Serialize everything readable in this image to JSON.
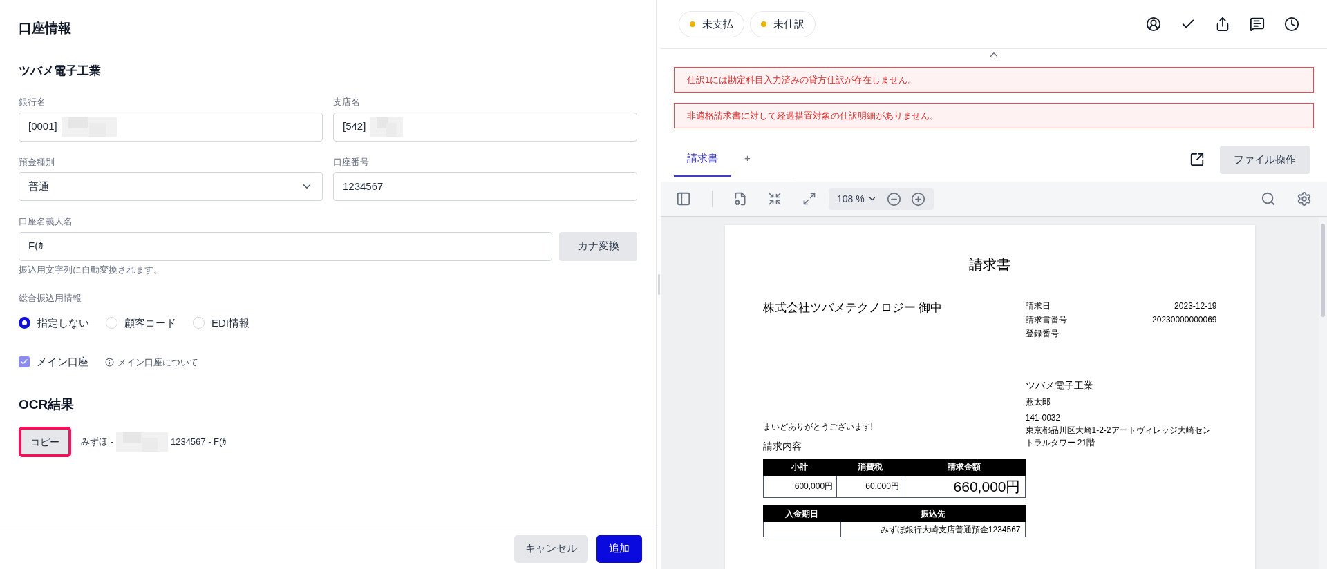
{
  "account_form": {
    "title": "口座情報",
    "company": "ツバメ電子工業",
    "bank": {
      "label": "銀行名",
      "value": "[0001]",
      "redacted": true
    },
    "branch": {
      "label": "支店名",
      "value": "[542]",
      "redacted": true
    },
    "deposit_type": {
      "label": "預金種別",
      "value": "普通"
    },
    "account_number": {
      "label": "口座番号",
      "value": "1234567"
    },
    "holder": {
      "label": "口座名義人名",
      "value": "F(ｶ",
      "button": "カナ変換",
      "hint": "振込用文字列に自動変換されます。"
    },
    "transfer_info": {
      "label": "総合振込用情報",
      "options": [
        {
          "label": "指定しない",
          "selected": true
        },
        {
          "label": "顧客コード",
          "selected": false
        },
        {
          "label": "EDI情報",
          "selected": false
        }
      ]
    },
    "main_account": {
      "label": "メイン口座",
      "checked": true,
      "link": "メイン口座について"
    }
  },
  "ocr": {
    "title": "OCR結果",
    "copy_button": "コピー",
    "highlighted": true,
    "text_before": "みずほ -",
    "redacted": true,
    "text_after": "1234567 - F(ｶ"
  },
  "footer_buttons": [
    {
      "label": "キャンセル",
      "kind": "secondary"
    },
    {
      "label": "追加",
      "kind": "primary"
    }
  ],
  "status_chips": [
    {
      "label": "未支払",
      "color": "#eab308"
    },
    {
      "label": "未仕訳",
      "color": "#eab308"
    }
  ],
  "alerts": [
    "仕訳1には勘定科目入力済みの貸方仕訳が存在しません。",
    "非適格請求書に対して経過措置対象の仕訳明細がありません。"
  ],
  "tabs": [
    {
      "label": "請求書",
      "selected": true
    },
    {
      "label": "+",
      "selected": false
    }
  ],
  "file_button": "ファイル操作",
  "viewer": {
    "zoom": "108 %"
  },
  "document": {
    "title": "請求書",
    "recipient": "株式会社ツバメテクノロジー 御中",
    "meta": [
      {
        "label": "請求日",
        "value": "2023-12-19"
      },
      {
        "label": "請求書番号",
        "value": "20230000000069"
      },
      {
        "label": "登録番号"
      }
    ],
    "sender": {
      "name": "ツバメ電子工業",
      "person": "燕太郎",
      "postal": "141-0032",
      "address_lines": [
        "東京都品川区大崎1-2-2アートヴィレッジ大崎セン",
        "トラルタワー 21階"
      ]
    },
    "greeting": "まいどありがとうございます!",
    "section": "請求内容",
    "summary": {
      "columns": [
        "小計",
        "消費税",
        "請求金額"
      ],
      "values": [
        "600,000円",
        "60,000円",
        "660,000円"
      ]
    },
    "payment": {
      "columns": [
        "入金期日",
        "振込先"
      ],
      "account": "みずほ銀行大崎支店普通預金1234567"
    }
  }
}
